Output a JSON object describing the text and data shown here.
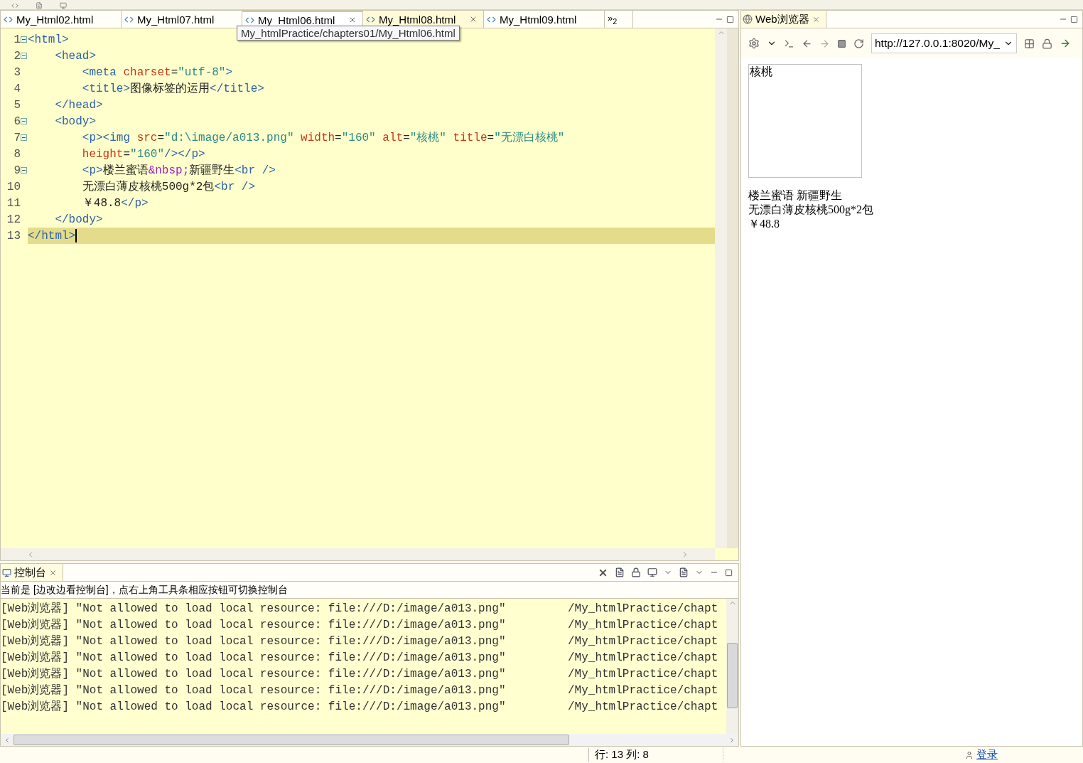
{
  "editor": {
    "tabs": [
      {
        "label": "My_Html02.html",
        "selected": false,
        "closable": false
      },
      {
        "label": "My_Html07.html",
        "selected": false,
        "closable": false
      },
      {
        "label": "My_Html06.html",
        "selected": true,
        "closable": true
      },
      {
        "label": "My_Html08.html",
        "selected": false,
        "closable": true
      },
      {
        "label": "My_Html09.html",
        "selected": false,
        "closable": false
      }
    ],
    "overflow": "»",
    "overflow_count": "2",
    "tooltip": "My_htmlPractice/chapters01/My_Html06.html",
    "lines": [
      {
        "number": "1",
        "fold": true,
        "current": false,
        "tokens": [
          {
            "kind": "tag",
            "text": "<html>"
          }
        ]
      },
      {
        "number": "2",
        "fold": true,
        "current": false,
        "tokens": [
          {
            "kind": "tag",
            "text": "    <head>"
          }
        ]
      },
      {
        "number": "3",
        "fold": false,
        "current": false,
        "tokens": [
          {
            "kind": "tag",
            "text": "        <meta"
          },
          {
            "kind": "attr",
            "text": " charset"
          },
          {
            "kind": "text",
            "text": "="
          },
          {
            "kind": "value",
            "text": "\"utf-8\""
          },
          {
            "kind": "tag",
            "text": ">"
          }
        ]
      },
      {
        "number": "4",
        "fold": false,
        "current": false,
        "tokens": [
          {
            "kind": "tag",
            "text": "        <title>"
          },
          {
            "kind": "text",
            "text": "图像标签的运用"
          },
          {
            "kind": "tag",
            "text": "</title>"
          }
        ]
      },
      {
        "number": "5",
        "fold": false,
        "current": false,
        "tokens": [
          {
            "kind": "tag",
            "text": "    </head>"
          }
        ]
      },
      {
        "number": "6",
        "fold": true,
        "current": false,
        "tokens": [
          {
            "kind": "tag",
            "text": "    <body>"
          }
        ]
      },
      {
        "number": "7",
        "fold": true,
        "current": false,
        "tokens": [
          {
            "kind": "tag",
            "text": "        <p><img"
          },
          {
            "kind": "attr",
            "text": " src"
          },
          {
            "kind": "text",
            "text": "="
          },
          {
            "kind": "value",
            "text": "\"d:\\image/a013.png\""
          },
          {
            "kind": "attr",
            "text": " width"
          },
          {
            "kind": "text",
            "text": "="
          },
          {
            "kind": "value",
            "text": "\"160\""
          },
          {
            "kind": "attr",
            "text": " alt"
          },
          {
            "kind": "text",
            "text": "="
          },
          {
            "kind": "value",
            "text": "\"核桃\""
          },
          {
            "kind": "attr",
            "text": " title"
          },
          {
            "kind": "text",
            "text": "="
          },
          {
            "kind": "value",
            "text": "\"无漂白核桃\""
          }
        ]
      },
      {
        "number": "8",
        "fold": false,
        "current": false,
        "tokens": [
          {
            "kind": "attr",
            "text": "        height"
          },
          {
            "kind": "text",
            "text": "="
          },
          {
            "kind": "value",
            "text": "\"160\""
          },
          {
            "kind": "tag",
            "text": "/></p>"
          }
        ]
      },
      {
        "number": "9",
        "fold": true,
        "current": false,
        "tokens": [
          {
            "kind": "tag",
            "text": "        <p>"
          },
          {
            "kind": "text",
            "text": "楼兰蜜语"
          },
          {
            "kind": "entity",
            "text": "&nbsp;"
          },
          {
            "kind": "text",
            "text": "新疆野生"
          },
          {
            "kind": "tag",
            "text": "<br />"
          }
        ]
      },
      {
        "number": "10",
        "fold": false,
        "current": false,
        "tokens": [
          {
            "kind": "text",
            "text": "        无漂白薄皮核桃500g*2包"
          },
          {
            "kind": "tag",
            "text": "<br />"
          }
        ]
      },
      {
        "number": "11",
        "fold": false,
        "current": false,
        "tokens": [
          {
            "kind": "text",
            "text": "        ￥48.8"
          },
          {
            "kind": "tag",
            "text": "</p>"
          }
        ]
      },
      {
        "number": "12",
        "fold": false,
        "current": false,
        "tokens": [
          {
            "kind": "tag",
            "text": "    </body>"
          }
        ]
      },
      {
        "number": "13",
        "fold": false,
        "current": true,
        "tokens": [
          {
            "kind": "tag",
            "text": "</html>"
          }
        ]
      }
    ]
  },
  "browser": {
    "tab": "Web浏览器",
    "url": "http://127.0.0.1:8020/My_",
    "image_alt": "核桃",
    "lines": [
      "楼兰蜜语 新疆野生",
      "无漂白薄皮核桃500g*2包",
      "￥48.8"
    ]
  },
  "console": {
    "tab": "控制台",
    "info": "当前是 [边改边看控制台]，点右上角工具条相应按钮可切换控制台",
    "rows": [
      {
        "message": "[Web浏览器] \"Not allowed to load local resource: file:///D:/image/a013.png\"",
        "source": "/My_htmlPractice/chapt"
      },
      {
        "message": "[Web浏览器] \"Not allowed to load local resource: file:///D:/image/a013.png\"",
        "source": "/My_htmlPractice/chapt"
      },
      {
        "message": "[Web浏览器] \"Not allowed to load local resource: file:///D:/image/a013.png\"",
        "source": "/My_htmlPractice/chapt"
      },
      {
        "message": "[Web浏览器] \"Not allowed to load local resource: file:///D:/image/a013.png\"",
        "source": "/My_htmlPractice/chapt"
      },
      {
        "message": "[Web浏览器] \"Not allowed to load local resource: file:///D:/image/a013.png\"",
        "source": "/My_htmlPractice/chapt"
      },
      {
        "message": "[Web浏览器] \"Not allowed to load local resource: file:///D:/image/a013.png\"",
        "source": "/My_htmlPractice/chapt"
      },
      {
        "message": "[Web浏览器] \"Not allowed to load local resource: file:///D:/image/a013.png\"",
        "source": "/My_htmlPractice/chapt"
      }
    ]
  },
  "status_bar": {
    "position": "行: 13 列: 8",
    "login": "登录"
  }
}
